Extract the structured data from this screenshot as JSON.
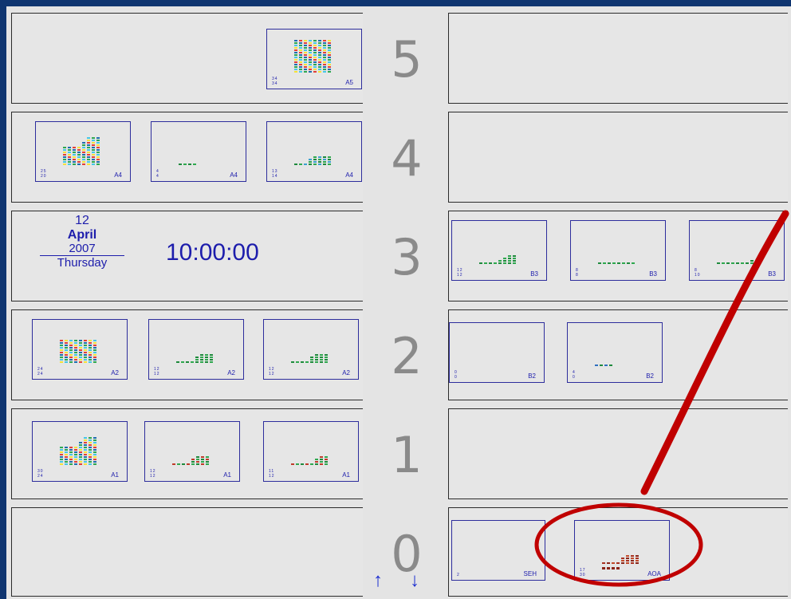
{
  "floors": [
    "5",
    "4",
    "3",
    "2",
    "1",
    "0"
  ],
  "date": {
    "day": "12",
    "month": "April",
    "year": "2007",
    "weekday": "Thursday"
  },
  "clock": "10:00:00",
  "cards": {
    "a5": {
      "label": "A5",
      "nums": "34\n34"
    },
    "a4_1": {
      "label": "A4",
      "nums": "25\n20"
    },
    "a4_2": {
      "label": "A4",
      "nums": "4\n4"
    },
    "a4_3": {
      "label": "A4",
      "nums": "13\n14"
    },
    "b3_1": {
      "label": "B3",
      "nums": "12\n12"
    },
    "b3_2": {
      "label": "B3",
      "nums": "8\n8"
    },
    "b3_3": {
      "label": "B3",
      "nums": "8\n10"
    },
    "a2_1": {
      "label": "A2",
      "nums": "24\n24"
    },
    "a2_2": {
      "label": "A2",
      "nums": "12\n12"
    },
    "a2_3": {
      "label": "A2",
      "nums": "12\n12"
    },
    "b2_1": {
      "label": "B2",
      "nums": "0\n0"
    },
    "b2_2": {
      "label": "B2",
      "nums": "4\n0"
    },
    "a1_1": {
      "label": "A1",
      "nums": "30\n24"
    },
    "a1_2": {
      "label": "A1",
      "nums": "12\n12"
    },
    "a1_3": {
      "label": "A1",
      "nums": "11\n12"
    },
    "seh": {
      "label": "SEH",
      "nums": "2"
    },
    "aoa": {
      "label": "AOA",
      "nums": "17\n30"
    }
  },
  "arrows": {
    "up": "↑",
    "down": "↓"
  },
  "colors": {
    "background": "#0f3570",
    "panel": "#e6e6e6",
    "accent": "#1d1dac",
    "highlight": "#c00000"
  }
}
